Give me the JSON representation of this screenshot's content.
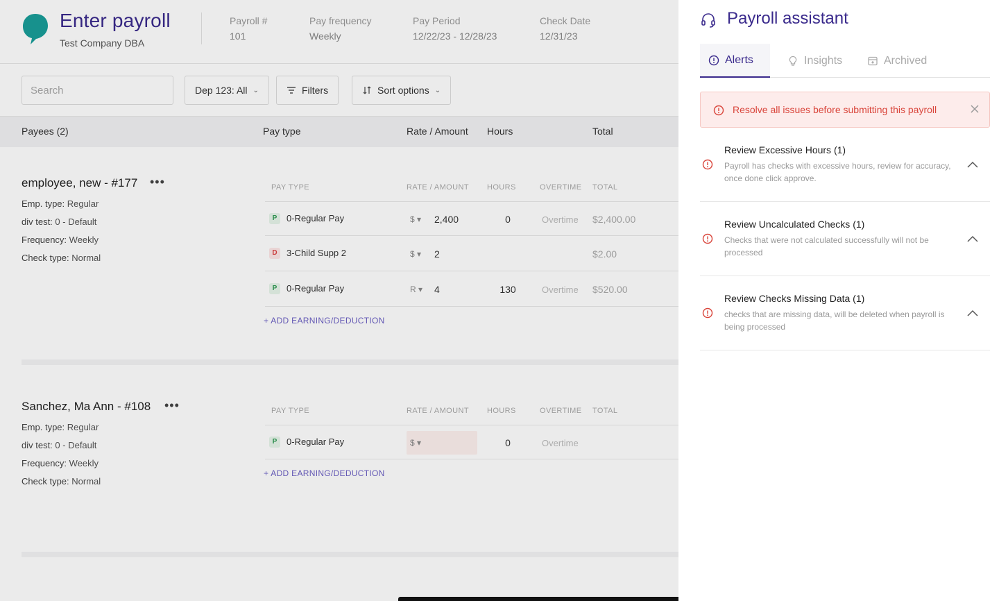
{
  "header": {
    "title": "Enter payroll",
    "company": "Test Company DBA",
    "meta": [
      {
        "label": "Payroll #",
        "value": "101"
      },
      {
        "label": "Pay frequency",
        "value": "Weekly"
      },
      {
        "label": "Pay Period",
        "value": "12/22/23 - 12/28/23"
      },
      {
        "label": "Check Date",
        "value": "12/31/23"
      }
    ]
  },
  "toolbar": {
    "search_placeholder": "Search",
    "department": "Dep 123: All",
    "filters": "Filters",
    "sort": "Sort options"
  },
  "columns": {
    "payees": "Payees (2)",
    "pay_type": "Pay type",
    "rate": "Rate / Amount",
    "hours": "Hours",
    "total": "Total"
  },
  "sub_columns": {
    "pay_type": "PAY TYPE",
    "rate": "RATE / AMOUNT",
    "hours": "HOURS",
    "overtime": "OVERTIME",
    "total": "TOTAL"
  },
  "employees": [
    {
      "name": "employee, new - #177",
      "emp_type_label": "Emp. type:",
      "emp_type": "Regular",
      "div_label": "div test:",
      "div": "0 - Default",
      "freq_label": "Frequency:",
      "freq": "Weekly",
      "check_label": "Check type:",
      "check": "Normal",
      "rows": [
        {
          "badge": "P",
          "pay": "0-Regular Pay",
          "rate_unit": "$ ▾",
          "rate": "2,400",
          "hours": "0",
          "overtime": "Overtime",
          "total": "$2,400.00"
        },
        {
          "badge": "D",
          "pay": "3-Child Supp 2",
          "rate_unit": "$ ▾",
          "rate": "2",
          "hours": "",
          "overtime": "",
          "total": "$2.00"
        },
        {
          "badge": "P",
          "pay": "0-Regular Pay",
          "rate_unit": "R ▾",
          "rate": "4",
          "hours": "130",
          "overtime": "Overtime",
          "total": "$520.00"
        }
      ],
      "add_link": "+ ADD EARNING/DEDUCTION"
    },
    {
      "name": "Sanchez, Ma Ann - #108",
      "emp_type_label": "Emp. type:",
      "emp_type": "Regular",
      "div_label": "div test:",
      "div": "0 - Default",
      "freq_label": "Frequency:",
      "freq": "Weekly",
      "check_label": "Check type:",
      "check": "Normal",
      "rows": [
        {
          "badge": "P",
          "pay": "0-Regular Pay",
          "rate_unit": "$ ▾",
          "rate": "",
          "hours": "0",
          "overtime": "Overtime",
          "total": ""
        }
      ],
      "add_link": "+ ADD EARNING/DEDUCTION"
    }
  ],
  "assistant": {
    "title": "Payroll assistant",
    "tabs": [
      {
        "label": "Alerts",
        "icon": "alert-circle-icon"
      },
      {
        "label": "Insights",
        "icon": "lightbulb-icon"
      },
      {
        "label": "Archived",
        "icon": "archive-icon"
      }
    ],
    "banner": "Resolve all issues before submitting this payroll",
    "issues": [
      {
        "title": "Review Excessive Hours (1)",
        "desc": "Payroll has checks with excessive hours, review for accuracy, once done click approve."
      },
      {
        "title": "Review Uncalculated Checks (1)",
        "desc": "Checks that were not calculated successfully will not be processed"
      },
      {
        "title": "Review Checks Missing Data (1)",
        "desc": "checks that are missing data, will be deleted when payroll is being processed"
      }
    ]
  },
  "colors": {
    "brand": "#3a2a8c",
    "alert": "#d9443a",
    "logo": "#1a9e9a"
  }
}
